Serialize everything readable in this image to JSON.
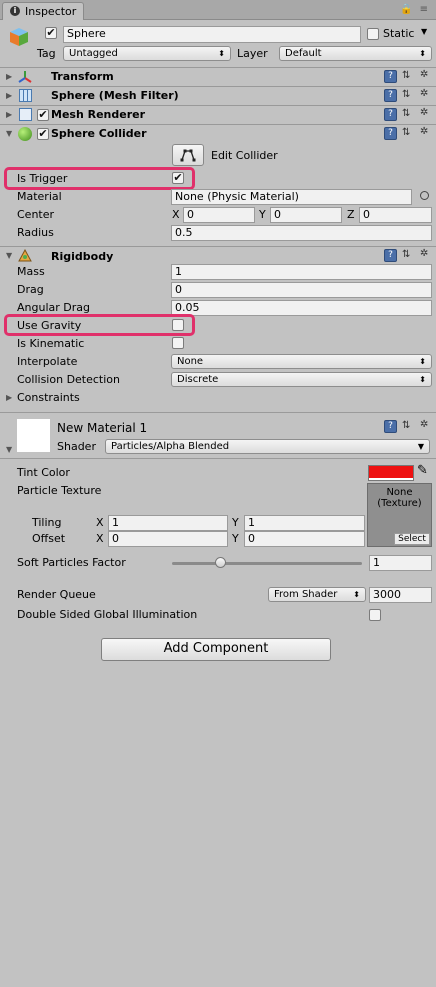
{
  "tab": {
    "title": "Inspector"
  },
  "object": {
    "name": "Sphere",
    "static_label": "Static",
    "tag_label": "Tag",
    "tag_value": "Untagged",
    "layer_label": "Layer",
    "layer_value": "Default"
  },
  "components": {
    "transform": "Transform",
    "mesh_filter": "Sphere (Mesh Filter)",
    "mesh_renderer": "Mesh Renderer",
    "sphere_collider": "Sphere Collider",
    "rigidbody": "Rigidbody"
  },
  "collider": {
    "edit_label": "Edit Collider",
    "is_trigger_label": "Is Trigger",
    "is_trigger_checked": true,
    "material_label": "Material",
    "material_value": "None (Physic Material)",
    "center_label": "Center",
    "cx": "0",
    "cy": "0",
    "cz": "0",
    "radius_label": "Radius",
    "radius_value": "0.5"
  },
  "rigidbody": {
    "mass_label": "Mass",
    "mass": "1",
    "drag_label": "Drag",
    "drag": "0",
    "angular_drag_label": "Angular Drag",
    "angular_drag": "0.05",
    "use_gravity_label": "Use Gravity",
    "use_gravity_checked": false,
    "is_kinematic_label": "Is Kinematic",
    "is_kinematic_checked": false,
    "interpolate_label": "Interpolate",
    "interpolate_value": "None",
    "collision_label": "Collision Detection",
    "collision_value": "Discrete",
    "constraints_label": "Constraints"
  },
  "material": {
    "name": "New Material 1",
    "shader_label": "Shader",
    "shader_value": "Particles/Alpha Blended",
    "tint_label": "Tint Color",
    "tint_color": "#ee1111",
    "texture_label": "Particle Texture",
    "texture_none": "None",
    "texture_type": "(Texture)",
    "select_label": "Select",
    "tiling_label": "Tiling",
    "tiling_x": "1",
    "tiling_y": "1",
    "offset_label": "Offset",
    "offset_x": "0",
    "offset_y": "0",
    "soft_label": "Soft Particles Factor",
    "soft_value": "1",
    "soft_fraction": 0.2,
    "queue_label": "Render Queue",
    "queue_mode": "From Shader",
    "queue_value": "3000",
    "dsgi_label": "Double Sided Global Illumination"
  },
  "axis": {
    "x": "X",
    "y": "Y",
    "z": "Z"
  },
  "add_component_label": "Add Component"
}
